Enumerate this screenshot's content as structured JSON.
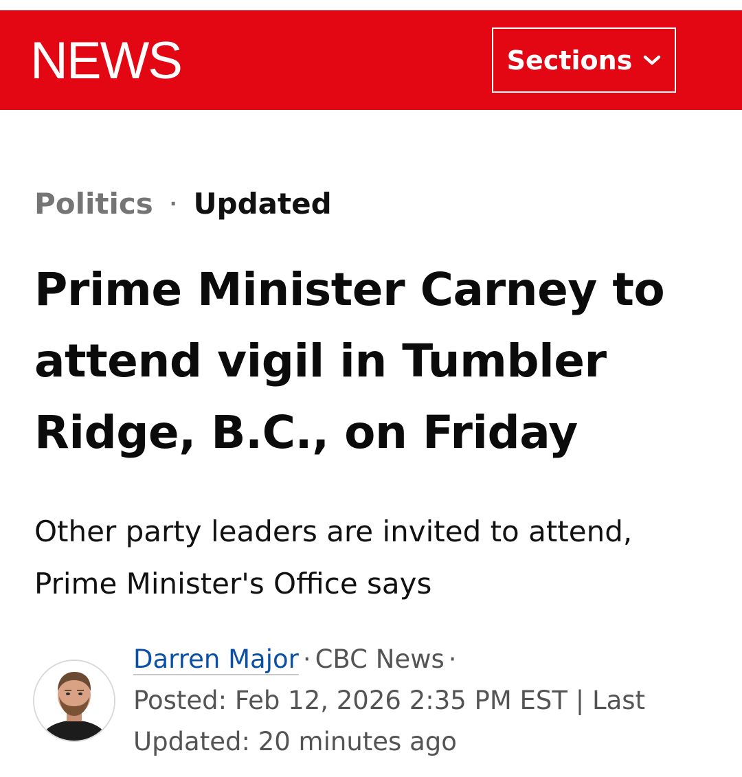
{
  "header": {
    "logo": "NEWS",
    "sections_label": "Sections",
    "accent_color": "#e30613"
  },
  "article": {
    "category": "Politics",
    "separator": "·",
    "status": "Updated",
    "headline": "Prime Minister Carney to attend vigil in Tumbler Ridge, B.C., on Friday",
    "dek": "Other party leaders are invited to attend, Prime Minister's Office says"
  },
  "byline": {
    "author": "Darren Major",
    "outlet": "CBC News",
    "dot": "·",
    "posted": "Posted: Feb 12, 2026 2:35 PM EST | Last Updated: 20 minutes ago"
  }
}
